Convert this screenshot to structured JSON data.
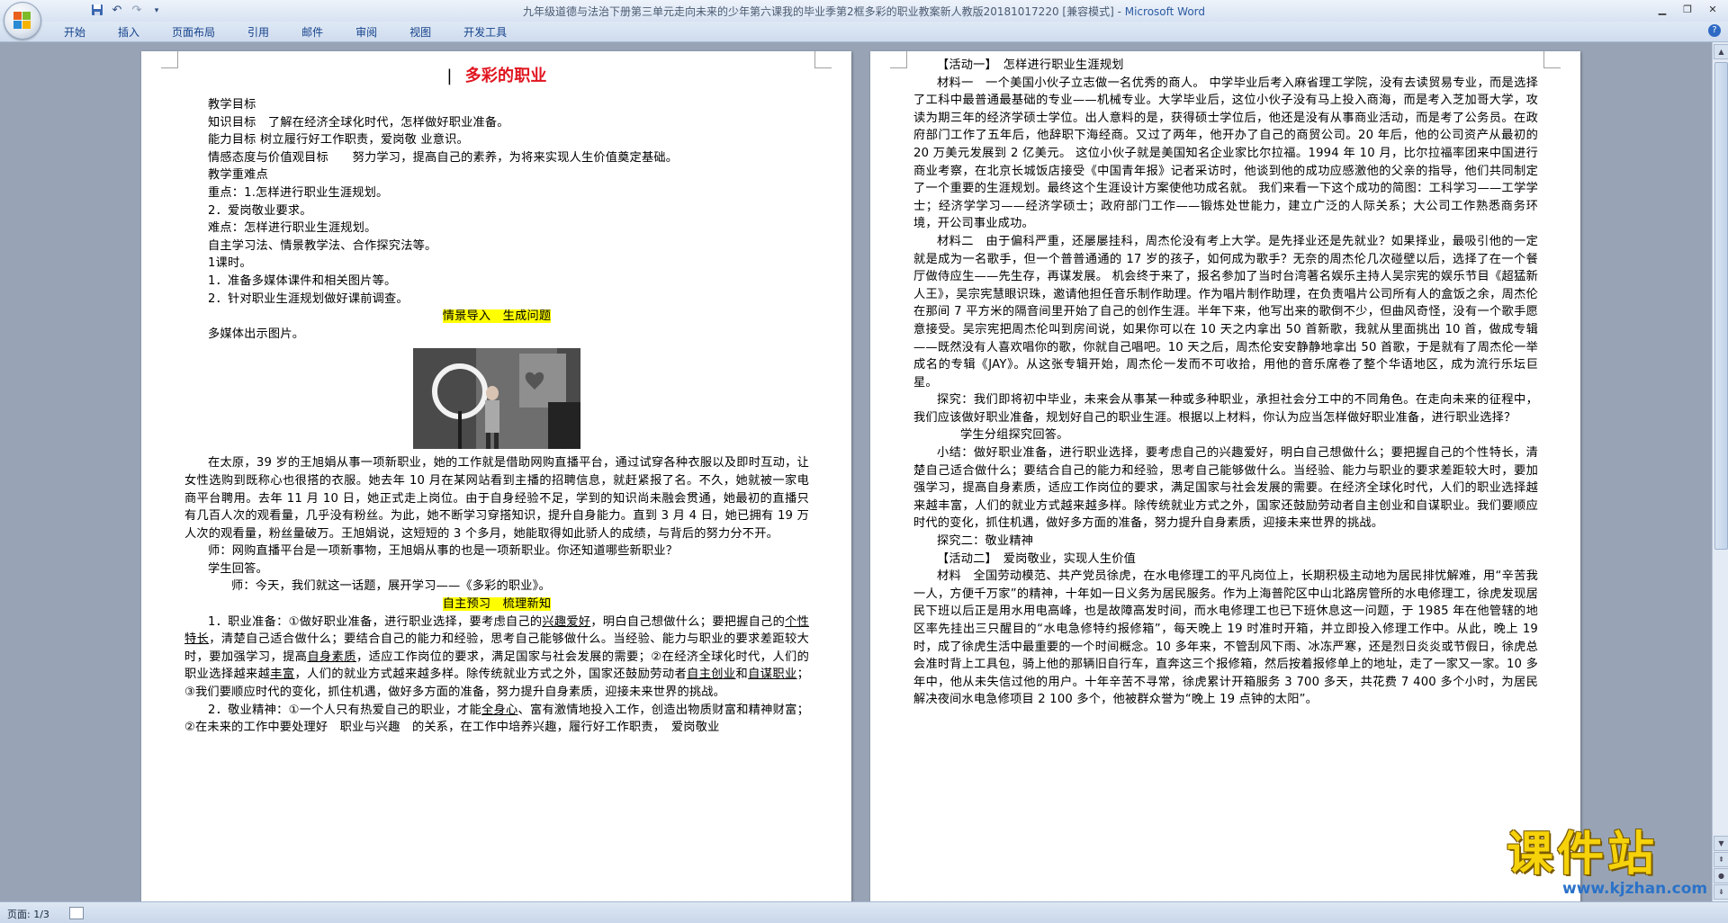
{
  "window": {
    "title": "九年级道德与法治下册第三单元走向未来的少年第六课我的毕业季第2框多彩的职业教案新人教版20181017220 [兼容模式] - ",
    "app_name": "Microsoft Word"
  },
  "ribbon": {
    "tabs": [
      "开始",
      "插入",
      "页面布局",
      "引用",
      "邮件",
      "审阅",
      "视图",
      "开发工具"
    ]
  },
  "status": {
    "page": "页面: 1/3"
  },
  "watermark": {
    "text": "课件站",
    "url": "www.kjzhan.com"
  },
  "page1": {
    "title": "多彩的职业",
    "lines": [
      "教学目标",
      "知识目标　了解在经济全球化时代，怎样做好职业准备。",
      "能力目标 树立履行好工作职责，爱岗敬 业意识。",
      "情感态度与价值观目标　　努力学习，提高自己的素养，为将来实现人生价值奠定基础。",
      "教学重难点",
      "重点：1.怎样进行职业生涯规划。",
      "2．爱岗敬业要求。",
      "难点：怎样进行职业生涯规划。",
      "自主学习法、情景教学法、合作探究法等。",
      "1课时。",
      "1．准备多媒体课件和相关图片等。",
      "2．针对职业生涯规划做好课前调查。"
    ],
    "section1": "情景导入　生成问题",
    "media_line": "多媒体出示图片。",
    "story": "在太原，39 岁的王旭娟从事一项新职业，她的工作就是借助网购直播平台，通过试穿各种衣服以及即时互动，让女性选购到既称心也很搭的衣服。她去年 10 月在某网站看到主播的招聘信息，就赶紧报了名。不久，她就被一家电商平台聘用。去年 11 月 10 日，她正式走上岗位。由于自身经验不足，学到的知识尚未融会贯通，她最初的直播只有几百人次的观看量，几乎没有粉丝。为此，她不断学习穿搭知识，提升自身能力。直到 3 月 4 日，她已拥有 19 万人次的观看量，粉丝量破万。王旭娟说，这短短的 3 个多月，她能取得如此骄人的成绩，与背后的努力分不开。",
    "teacher_q": "师：网购直播平台是一项新事物，王旭娟从事的也是一项新职业。你还知道哪些新职业？",
    "student_a": "学生回答。",
    "teacher_intro": "师：今天，我们就这一话题，展开学习——《多彩的职业》。",
    "section2": "自主预习　梳理新知",
    "prep": {
      "a": "1．职业准备：①做好职业准备，进行职业选择，要考虑自己的",
      "b1": "兴趣爱好",
      "a2": "，明白自己想做什么；要把握自己的",
      "b2": "个性特长",
      "a3": "，清楚自己适合做什么；要结合自己的能力和经验，思考自己能够做什么。当经验、能力与职业的要求差距较大时，要加强学习，提高",
      "b3": "自身素质",
      "a4": "，适应工作岗位的要求，满足国家与社会发展的需要；②在经济全球化时代，人们的职业选择越来越",
      "b4": "丰富",
      "a5": "，人们的就业方式越来越多样。除传统就业方式之外，国家还鼓励劳动者",
      "b5": "自主创业",
      "a6": "和",
      "b6": "自谋职业",
      "a7": "；③我们要顺应时代的变化，抓住机遇，做好多方面的准备，努力提升自身素质，迎接未来世界的挑战。"
    },
    "dedication": {
      "a": "2．敬业精神：①一个人只有热爱自己的职业，才能",
      "b1": "全身心",
      "a2": "、富有激情地投入工作，创造出物质财富和精神财富；②在未来的工作中要处理好　职业与兴趣　的关系，在工作中培养兴趣，履行好工作职责，　爱岗敬业"
    }
  },
  "page2": {
    "activity1": "【活动一】　怎样进行职业生涯规划",
    "material1": "材料一　一个美国小伙子立志做一名优秀的商人。 中学毕业后考入麻省理工学院，没有去读贸易专业，而是选择了工科中最普通最基础的专业——机械专业。大学毕业后，这位小伙子没有马上投入商海，而是考入芝加哥大学，攻读为期三年的经济学硕士学位。出人意料的是，获得硕士学位后，他还是没有从事商业活动，而是考了公务员。在政府部门工作了五年后，他辞职下海经商。又过了两年，他开办了自己的商贸公司。20 年后，他的公司资产从最初的 20 万美元发展到 2 亿美元。 这位小伙子就是美国知名企业家比尔拉福。1994 年 10 月，比尔拉福率团来中国进行商业考察，在北京长城饭店接受《中国青年报》记者采访时，他谈到他的成功应感激他的父亲的指导，他们共同制定了一个重要的生涯规划。最终这个生涯设计方案使他功成名就。 我们来看一下这个成功的简图：工科学习——工学学士；经济学学习——经济学硕士；政府部门工作——锻炼处世能力，建立广泛的人际关系；大公司工作熟悉商务环境，开公司事业成功。",
    "material2": "材料二　由于偏科严重，还屡屡挂科，周杰伦没有考上大学。是先择业还是先就业？如果择业，最吸引他的一定就是成为一名歌手，但一个普普通通的 17 岁的孩子，如何成为歌手？无奈的周杰伦几次碰壁以后，选择了在一个餐厅做侍应生——先生存，再谋发展。 机会终于来了，报名参加了当时台湾著名娱乐主持人吴宗宪的娱乐节目《超猛新人王》，吴宗宪慧眼识珠，邀请他担任音乐制作助理。作为唱片制作助理，在负责唱片公司所有人的盒饭之余，周杰伦在那间 7 平方米的隔音间里开始了自己的创作生涯。半年下来，他写出来的歌倒不少，但曲风奇怪，没有一个歌手愿意接受。吴宗宪把周杰伦叫到房间说，如果你可以在 10 天之内拿出 50 首新歌，我就从里面挑出 10 首，做成专辑——既然没有人喜欢唱你的歌，你就自己唱吧。10 天之后，周杰伦安安静静地拿出 50 首歌，于是就有了周杰伦一举成名的专辑《JAY》。从这张专辑开始，周杰伦一发而不可收拾，用他的音乐席卷了整个华语地区，成为流行乐坛巨星。",
    "inquiry1": "探究：我们即将初中毕业，未来会从事某一种或多种职业，承担社会分工中的不同角色。在走向未来的征程中，我们应该做好职业准备，规划好自己的职业生涯。根据以上材料，你认为应当怎样做好职业准备，进行职业选择？",
    "group": "学生分组探究回答。",
    "summary": "小结：做好职业准备，进行职业选择，要考虑自己的兴趣爱好，明白自己想做什么；要把握自己的个性特长，清楚自己适合做什么；要结合自己的能力和经验，思考自己能够做什么。当经验、能力与职业的要求差距较大时，要加强学习，提高自身素质，适应工作岗位的要求，满足国家与社会发展的需要。在经济全球化时代，人们的职业选择越来越丰富，人们的就业方式越来越多样。除传统就业方式之外，国家还鼓励劳动者自主创业和自谋职业。我们要顺应时代的变化，抓住机遇，做好多方面的准备，努力提升自身素质，迎接未来世界的挑战。",
    "inquiry2": "探究二：敬业精神",
    "activity2": "【活动二】　爱岗敬业，实现人生价值",
    "material3": "材料　全国劳动模范、共产党员徐虎，在水电修理工的平凡岗位上，长期积极主动地为居民排忧解难，用“辛苦我一人，方便千万家”的精神，十年如一日义务为居民服务。作为上海普陀区中山北路房管所的水电修理工，徐虎发现居民下班以后正是用水用电高峰，也是故障高发时间，而水电修理工也已下班休息这一问题，于 1985 年在他管辖的地区率先挂出三只醒目的“水电急修特约报修箱”，每天晚上 19 时准时开箱，并立即投入修理工作中。从此，晚上 19 时，成了徐虎生活中最重要的一个时间概念。10 多年来，不管刮风下雨、冰冻严寒，还是烈日炎炎或节假日，徐虎总会准时背上工具包，骑上他的那辆旧自行车，直奔这三个报修箱，然后按着报修单上的地址，走了一家又一家。10 多年中，他从未失信过他的用户。十年辛苦不寻常，徐虎累计开箱服务 3 700 多天，共花费 7 400 多个小时，为居民解决夜间水电急修项目 2 100 多个，他被群众誉为“晚上 19 点钟的太阳”。"
  }
}
